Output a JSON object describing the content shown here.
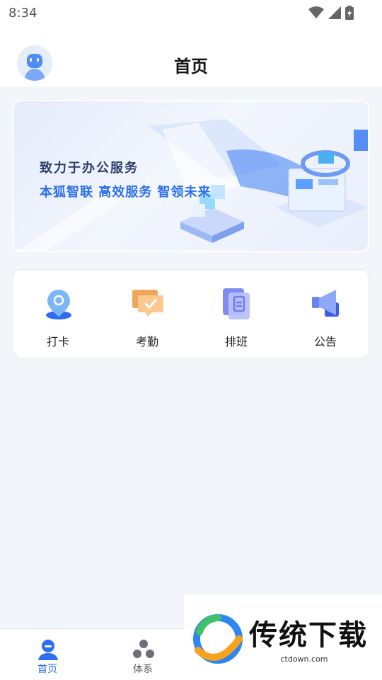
{
  "status": {
    "time": "8:34"
  },
  "header": {
    "title": "首页"
  },
  "banner": {
    "line1": "致力于办公服务",
    "line2": "本狐智联 高效服务 智领未来"
  },
  "quick_actions": [
    {
      "label": "打卡",
      "icon": "location-pin-icon"
    },
    {
      "label": "考勤",
      "icon": "attendance-chat-icon"
    },
    {
      "label": "排班",
      "icon": "schedule-clipboard-icon"
    },
    {
      "label": "公告",
      "icon": "megaphone-icon"
    }
  ],
  "tabs": [
    {
      "label": "首页",
      "icon": "home-avatar-icon",
      "active": true
    },
    {
      "label": "体系",
      "icon": "system-nodes-icon",
      "active": false
    }
  ],
  "watermark": {
    "brand": "传统下载",
    "url": "ctdown.com"
  },
  "colors": {
    "accent": "#2d6df2",
    "background": "#f2f5fa"
  }
}
